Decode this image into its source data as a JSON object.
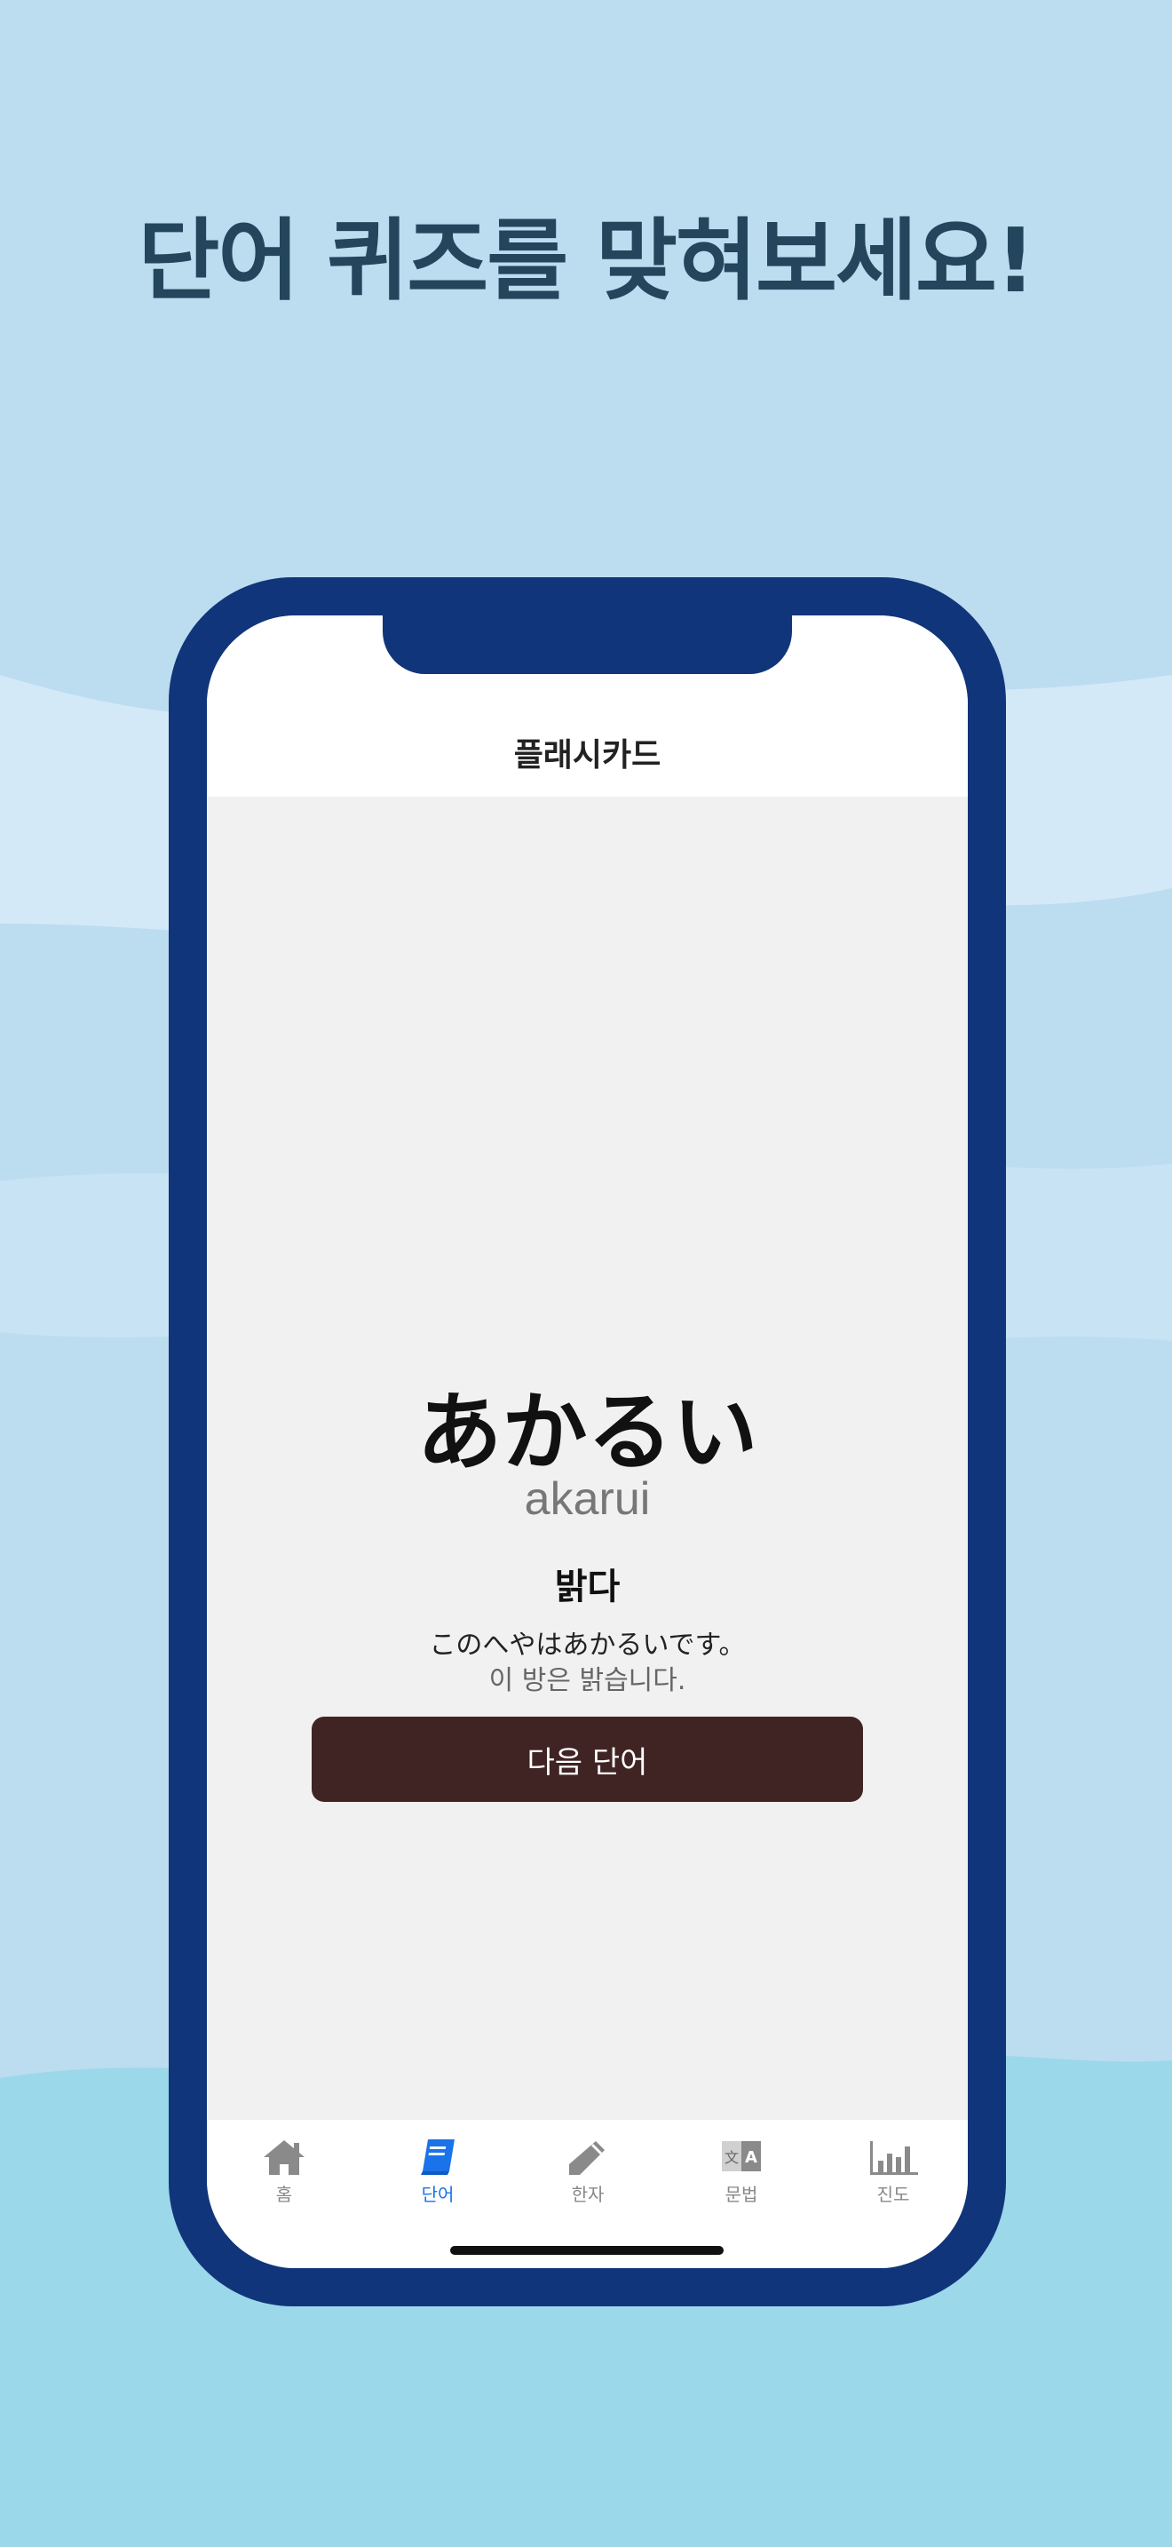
{
  "headline": "단어 퀴즈를 맞혀보세요!",
  "nav": {
    "title": "플래시카드"
  },
  "card": {
    "word": "あかるい",
    "romaji": "akarui",
    "meaning": "밝다",
    "example_jp": "このへやはあかるいです。",
    "example_ko": "이 방은 밝습니다.",
    "next_label": "다음 단어"
  },
  "tabs": [
    {
      "label": "홈",
      "icon": "home-icon",
      "active": false
    },
    {
      "label": "단어",
      "icon": "book-icon",
      "active": true
    },
    {
      "label": "한자",
      "icon": "pencil-icon",
      "active": false
    },
    {
      "label": "문법",
      "icon": "translate-icon",
      "active": false
    },
    {
      "label": "진도",
      "icon": "bar-chart-icon",
      "active": false
    }
  ],
  "colors": {
    "accent": "#1a73e8",
    "phone_frame": "#11357a",
    "button": "#402423",
    "headline": "#23465d"
  }
}
